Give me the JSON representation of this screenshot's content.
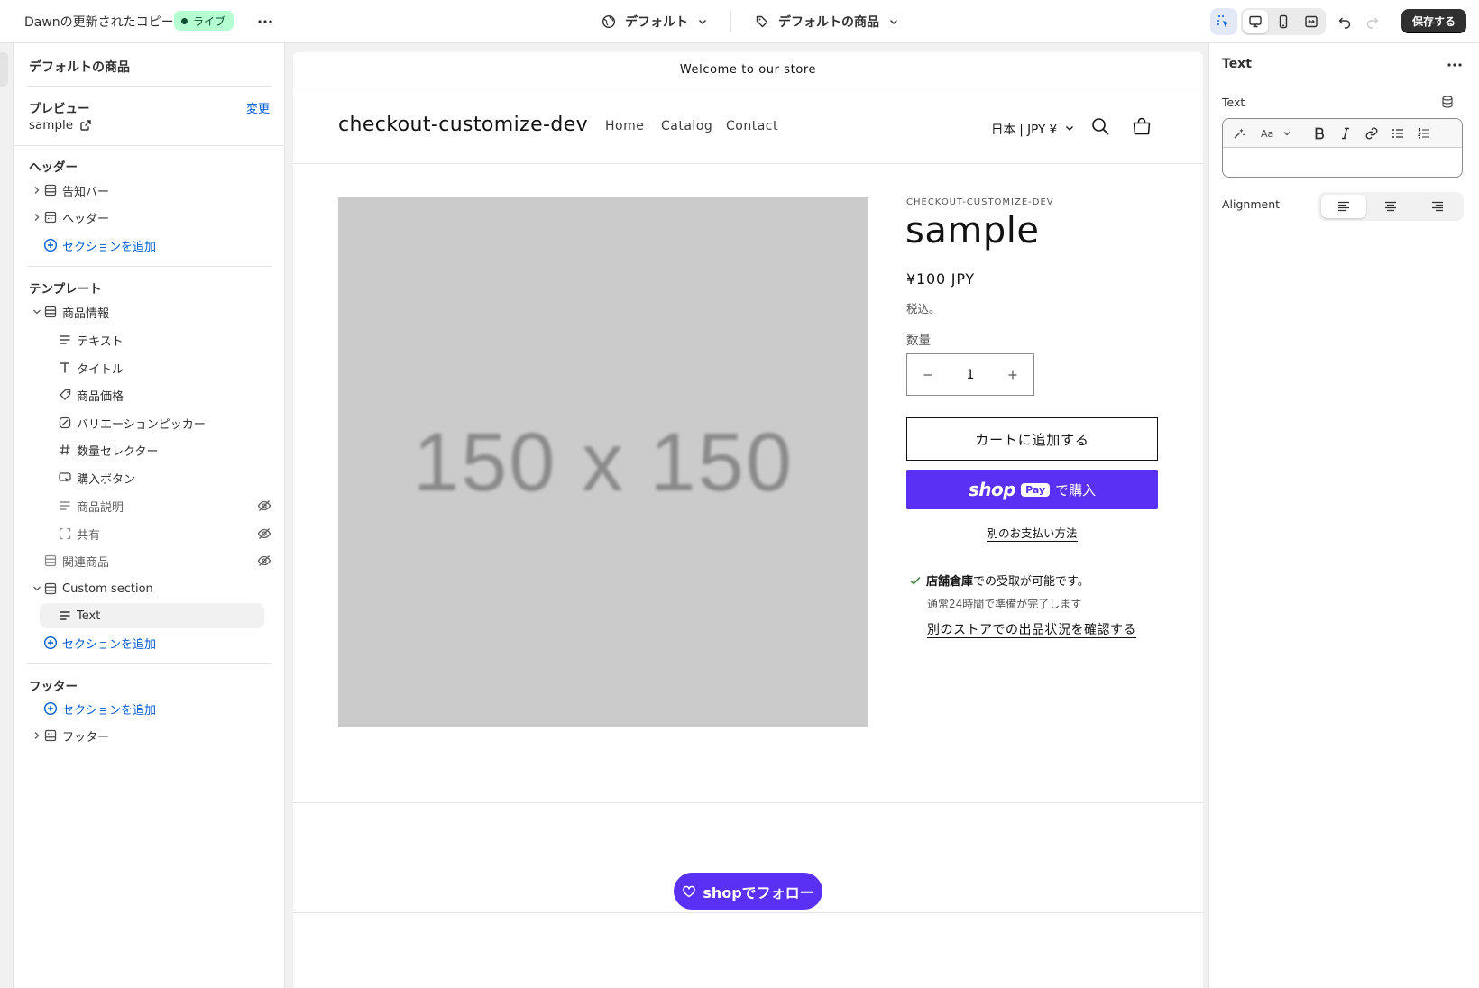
{
  "topbar": {
    "theme_name": "Dawnの更新されたコピー",
    "status_badge": "ライブ",
    "template_select": "デフォルト",
    "product_select": "デフォルトの商品",
    "save_label": "保存する"
  },
  "sidebar": {
    "page_title": "デフォルトの商品",
    "preview_label": "プレビュー",
    "preview_change": "変更",
    "preview_value": "sample",
    "header_group": {
      "title": "ヘッダー",
      "items": [
        {
          "label": "告知バー",
          "icon": "section-icon"
        },
        {
          "label": "ヘッダー",
          "icon": "header-section-icon"
        }
      ],
      "add_label": "セクションを追加"
    },
    "template_group": {
      "title": "テンプレート",
      "product_info": {
        "label": "商品情報",
        "blocks": [
          {
            "label": "テキスト",
            "icon": "text-block-icon",
            "hidden": false
          },
          {
            "label": "タイトル",
            "icon": "title-icon",
            "hidden": false
          },
          {
            "label": "商品価格",
            "icon": "price-icon",
            "hidden": false
          },
          {
            "label": "バリエーションピッカー",
            "icon": "variant-picker-icon",
            "hidden": false
          },
          {
            "label": "数量セレクター",
            "icon": "hash-icon",
            "hidden": false
          },
          {
            "label": "購入ボタン",
            "icon": "buy-button-icon",
            "hidden": false
          },
          {
            "label": "商品説明",
            "icon": "text-block-icon",
            "hidden": true
          },
          {
            "label": "共有",
            "icon": "share-icon",
            "hidden": true
          }
        ]
      },
      "related_products": {
        "label": "関連商品",
        "hidden": true
      },
      "custom_section": {
        "label": "Custom section",
        "blocks": [
          {
            "label": "Text"
          }
        ]
      },
      "add_label": "セクションを追加"
    },
    "footer_group": {
      "title": "フッター",
      "add_label": "セクションを追加",
      "items": [
        {
          "label": "フッター"
        }
      ]
    }
  },
  "preview": {
    "announcement": "Welcome to our store",
    "store_name": "checkout-customize-dev",
    "nav": [
      "Home",
      "Catalog",
      "Contact"
    ],
    "currency": "日本 | JPY ¥",
    "image_placeholder": "150 x 150",
    "vendor": "CHECKOUT-CUSTOMIZE-DEV",
    "product_title": "sample",
    "price": "¥100 JPY",
    "tax_note": "税込。",
    "quantity_label": "数量",
    "quantity_value": "1",
    "add_to_cart": "カートに追加する",
    "shop_pay": {
      "shop": "shop",
      "pay": "Pay",
      "buy": "で購入"
    },
    "more_payment": "別のお支払い方法",
    "pickup": {
      "location": "店舗倉庫",
      "availability": "での受取が可能です。",
      "ready_time": "通常24時間で準備が完了します",
      "check_stores": "別のストアでの出品状況を確認する"
    },
    "follow_button": {
      "shop": "shop",
      "label": "でフォロー"
    }
  },
  "right_panel": {
    "title": "Text",
    "field_label": "Text",
    "text_value": "",
    "alignment_label": "Alignment",
    "alignment_selected": "left",
    "toolbar": [
      "magic-icon",
      "font-size-icon",
      "bold-icon",
      "italic-icon",
      "link-icon",
      "bullet-list-icon",
      "numbered-list-icon"
    ]
  },
  "colors": {
    "brand_purple": "#5a31f4",
    "live_badge_bg": "#b4fed2",
    "link_blue": "#005bd3",
    "save_button": "#303030"
  }
}
